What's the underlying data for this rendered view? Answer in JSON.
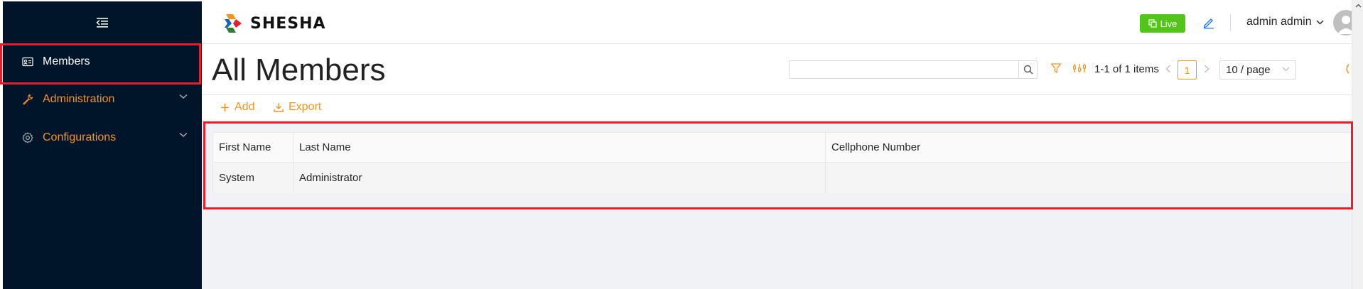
{
  "app": {
    "brand": "SHESHA",
    "accent_color": "#f7931e",
    "sidebar_color": "#001529",
    "highlight_color": "#e3202b"
  },
  "sidebar": {
    "toggle_icon": "menu-fold-icon",
    "items": [
      {
        "label": "Members",
        "icon": "idcard-icon",
        "active": true
      },
      {
        "label": "Administration",
        "icon": "tool-icon",
        "expandable": true
      },
      {
        "label": "Configurations",
        "icon": "setting-icon",
        "expandable": true
      }
    ]
  },
  "header": {
    "live_label": "Live",
    "live_color": "#52c41a",
    "user_name": "admin admin"
  },
  "page": {
    "title": "All Members",
    "search": {
      "value": "",
      "placeholder": ""
    },
    "pagination": {
      "total_text": "1-1 of 1 items",
      "current_page": "1",
      "page_size": "10 / page"
    }
  },
  "toolbar": {
    "add_label": "Add",
    "export_label": "Export"
  },
  "table": {
    "columns": [
      "First Name",
      "Last Name",
      "Cellphone Number"
    ],
    "rows": [
      [
        "System",
        "Administrator",
        ""
      ]
    ]
  }
}
